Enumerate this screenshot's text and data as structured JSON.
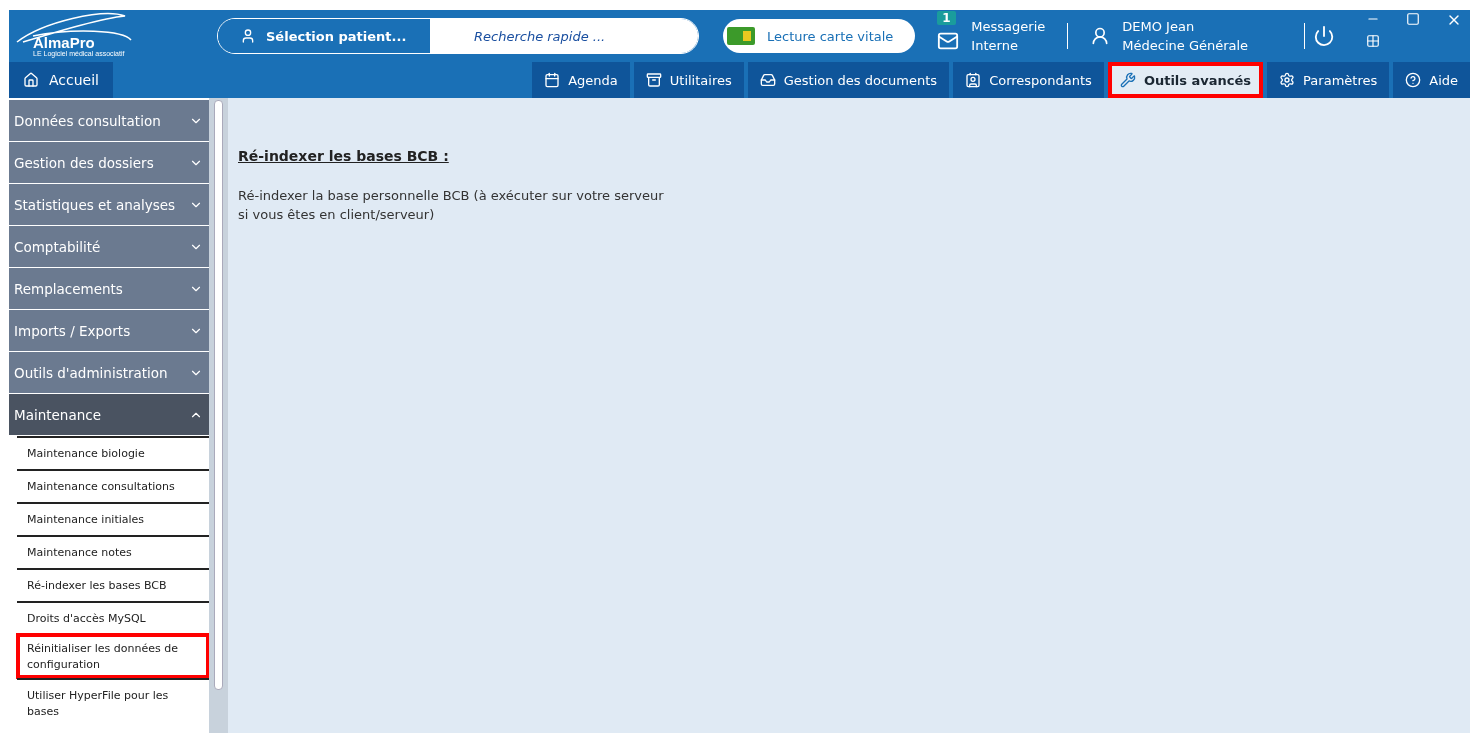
{
  "header": {
    "logo": {
      "name": "AlmaPro",
      "tagline": "LE Logiciel médical associatif"
    },
    "patient_button": "Sélection patient...",
    "search": {
      "placeholder": "Recherche rapide ..."
    },
    "vitale_button": "Lecture carte vitale",
    "messaging": {
      "badge": "1",
      "line1": "Messagerie",
      "line2": "Interne"
    },
    "user": {
      "name": "DEMO Jean",
      "specialty": "Médecine Générale"
    }
  },
  "nav": {
    "home": "Accueil",
    "tabs": [
      {
        "label": "Agenda",
        "kind": "calendar",
        "selected": false,
        "highlighted": false
      },
      {
        "label": "Utilitaires",
        "kind": "archive",
        "selected": false,
        "highlighted": false
      },
      {
        "label": "Gestion des documents",
        "kind": "inbox",
        "selected": false,
        "highlighted": false
      },
      {
        "label": "Correspondants",
        "kind": "contact",
        "selected": false,
        "highlighted": false
      },
      {
        "label": "Outils avancés",
        "kind": "wrench",
        "selected": true,
        "highlighted": true
      },
      {
        "label": "Paramètres",
        "kind": "gear",
        "selected": false,
        "highlighted": false
      },
      {
        "label": "Aide",
        "kind": "help",
        "selected": false,
        "highlighted": false
      }
    ]
  },
  "sidebar": {
    "sections": [
      {
        "label": "Données consultation",
        "expanded": false
      },
      {
        "label": "Gestion des dossiers",
        "expanded": false
      },
      {
        "label": "Statistiques et analyses",
        "expanded": false
      },
      {
        "label": "Comptabilité",
        "expanded": false
      },
      {
        "label": "Remplacements",
        "expanded": false
      },
      {
        "label": "Imports / Exports",
        "expanded": false
      },
      {
        "label": "Outils d'administration",
        "expanded": false
      },
      {
        "label": "Maintenance",
        "expanded": true,
        "children": [
          {
            "label": "Maintenance biologie",
            "highlighted": false
          },
          {
            "label": "Maintenance consultations",
            "highlighted": false
          },
          {
            "label": "Maintenance initiales",
            "highlighted": false
          },
          {
            "label": "Maintenance notes",
            "highlighted": false
          },
          {
            "label": "Ré-indexer les bases BCB",
            "highlighted": false
          },
          {
            "label": "Droits d'accès MySQL",
            "highlighted": false
          },
          {
            "label": "Réinitialiser les données de configuration",
            "highlighted": true
          },
          {
            "label": "Utiliser HyperFile pour les bases",
            "highlighted": false
          }
        ]
      }
    ]
  },
  "content": {
    "title": "Ré-indexer les bases BCB :",
    "text": "Ré-indexer la base personnelle BCB (à exécuter sur votre serveur si vous êtes en client/serveur)"
  }
}
